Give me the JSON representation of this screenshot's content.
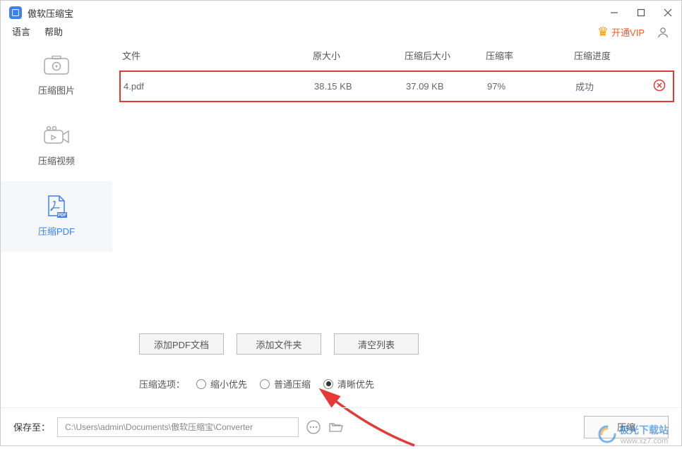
{
  "app": {
    "title": "傲软压缩宝"
  },
  "menu": {
    "language": "语言",
    "help": "帮助"
  },
  "vip": {
    "label": "开通VIP"
  },
  "sidebar": {
    "items": [
      {
        "label": "压缩图片"
      },
      {
        "label": "压缩视频"
      },
      {
        "label": "压缩PDF"
      }
    ]
  },
  "table": {
    "headers": {
      "file": "文件",
      "orig": "原大小",
      "comp": "压缩后大小",
      "rate": "压缩率",
      "prog": "压缩进度"
    },
    "rows": [
      {
        "file": "4.pdf",
        "orig": "38.15 KB",
        "comp": "37.09 KB",
        "rate": "97%",
        "prog": "成功"
      }
    ]
  },
  "buttons": {
    "addFile": "添加PDF文档",
    "addFolder": "添加文件夹",
    "clear": "清空列表"
  },
  "options": {
    "label": "压缩选项：",
    "items": [
      {
        "label": "缩小优先",
        "checked": false
      },
      {
        "label": "普通压缩",
        "checked": false
      },
      {
        "label": "清晰优先",
        "checked": true
      }
    ]
  },
  "footer": {
    "saveTo": "保存至：",
    "path": "C:\\Users\\admin\\Documents\\傲软压缩宝\\Converter",
    "compress": "压缩"
  },
  "watermark": {
    "text1": "极光下载站",
    "text2": "www.xz7.com"
  }
}
